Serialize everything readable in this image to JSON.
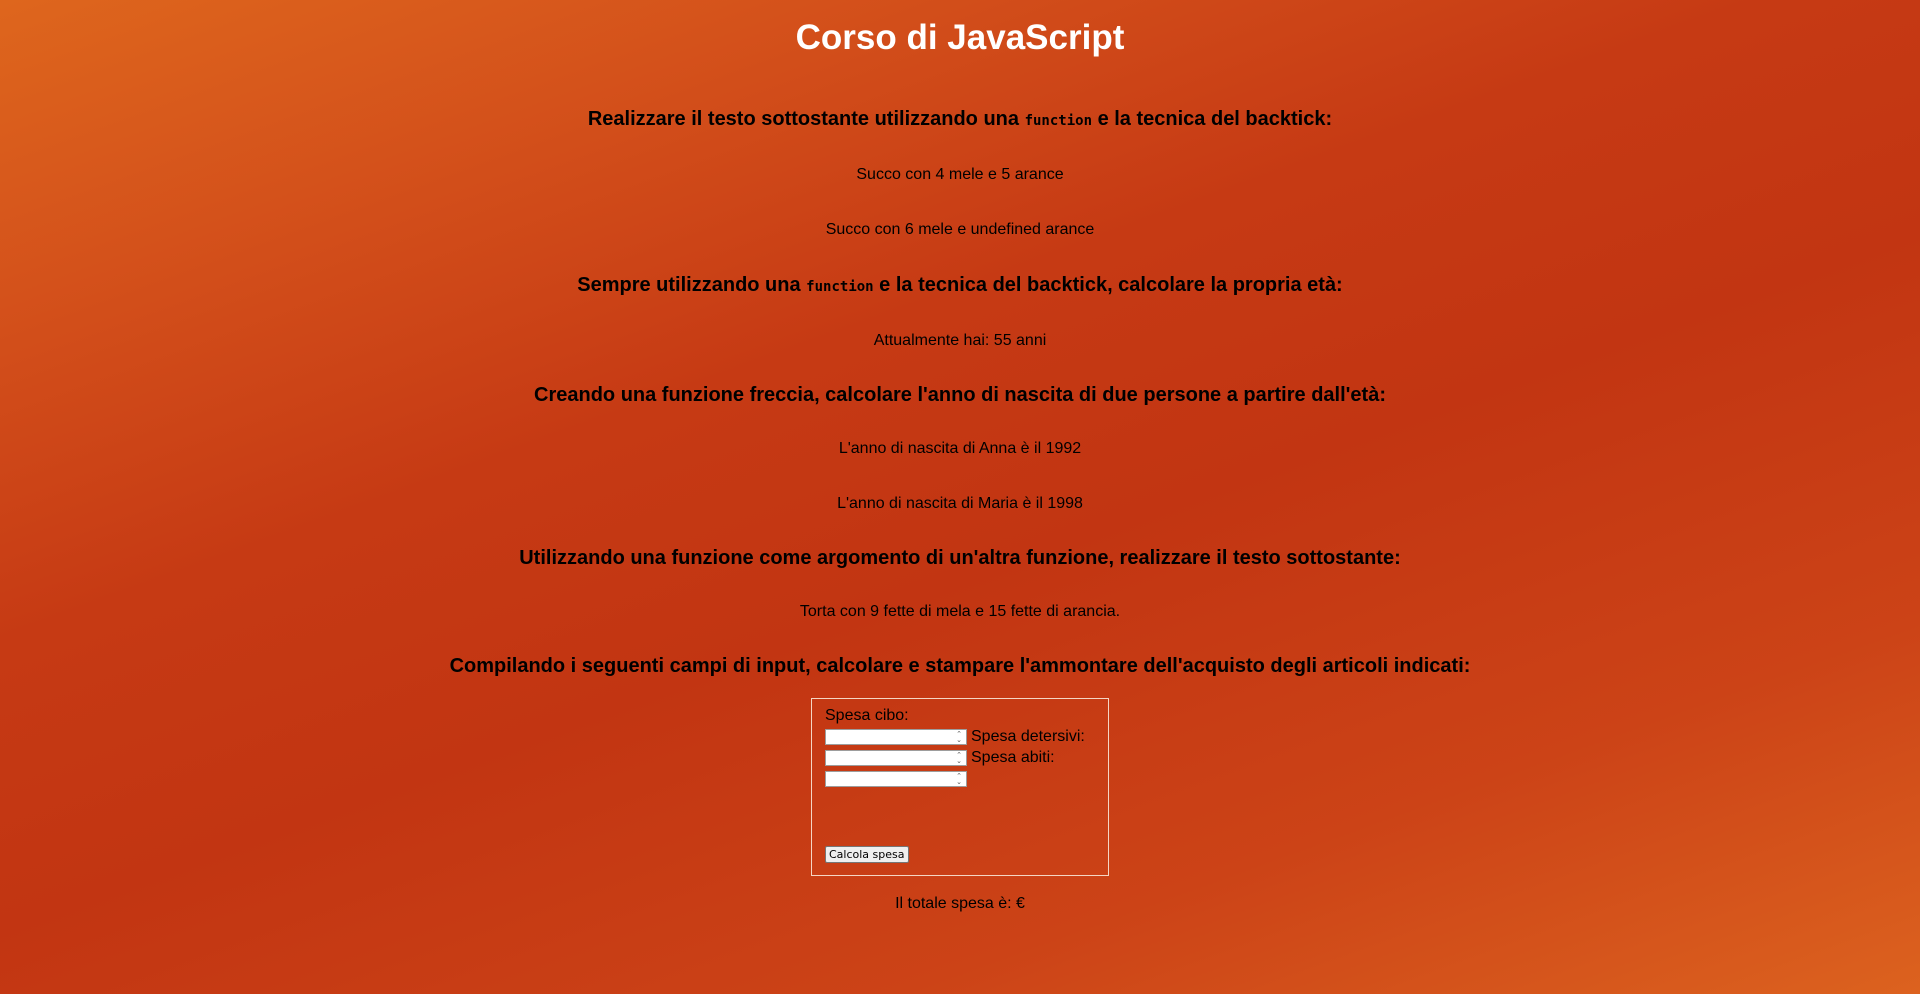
{
  "title": "Corso di JavaScript",
  "section1": {
    "heading_before": "Realizzare il testo sottostante utilizzando una ",
    "heading_code": "function",
    "heading_after": " e la tecnica del backtick:",
    "line1": "Succo con 4 mele e 5 arance",
    "line2": "Succo con 6 mele e undefined arance"
  },
  "section2": {
    "heading_before": "Sempre utilizzando una ",
    "heading_code": "function",
    "heading_after": " e la tecnica del backtick, calcolare la propria età:",
    "line1": "Attualmente hai: 55 anni"
  },
  "section3": {
    "heading": "Creando una funzione freccia, calcolare l'anno di nascita di due persone a partire dall'età:",
    "line1": "L'anno di nascita di Anna è il 1992",
    "line2": "L'anno di nascita di Maria è il 1998"
  },
  "section4": {
    "heading": "Utilizzando una funzione come argomento di un'altra funzione, realizzare il testo sottostante:",
    "line1": "Torta con 9 fette di mela e 15 fette di arancia."
  },
  "section5": {
    "heading": "Compilando i seguenti campi di input, calcolare e stampare l'ammontare dell'acquisto degli articoli indicati:",
    "form": {
      "food_label": "Spesa cibo:",
      "detergent_label": "Spesa detersivi:",
      "clothes_label": "Spesa abiti:",
      "food_value": "",
      "detergent_value": "",
      "clothes_value": "",
      "button_label": "Calcola spesa"
    },
    "total_text": "Il totale spesa è: €"
  },
  "icons": {
    "spinner": "spinner-arrows-icon"
  }
}
